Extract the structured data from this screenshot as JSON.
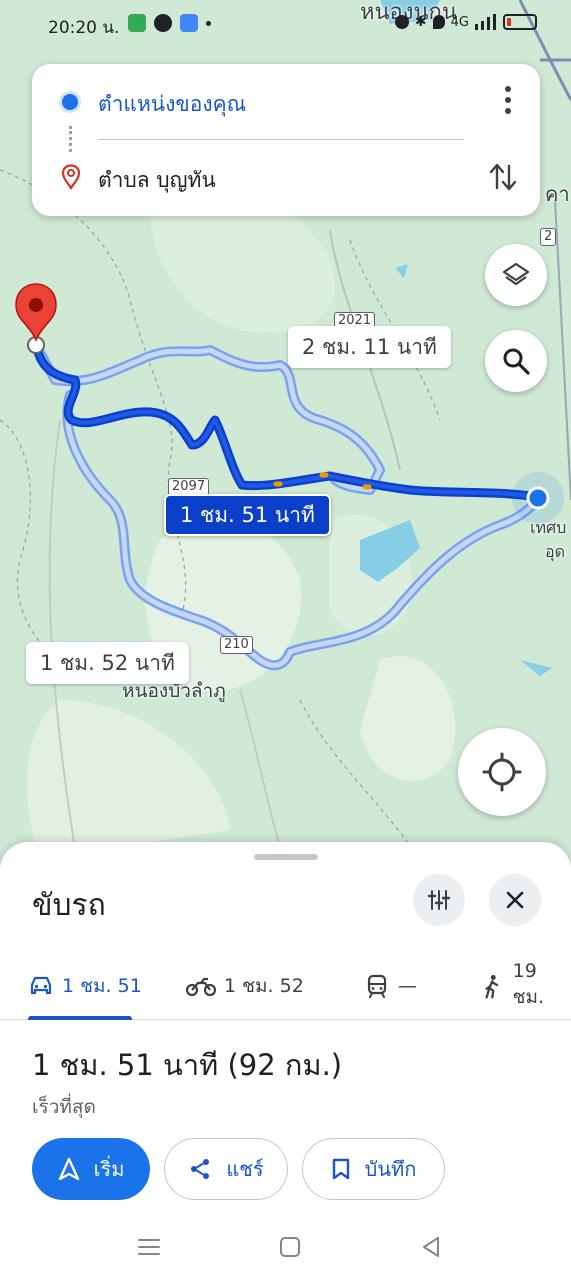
{
  "status_bar": {
    "time": "20:20 น.",
    "network": "4G",
    "map_fragment_top": "หนองนกน",
    "map_fragment_right": "คา"
  },
  "search": {
    "origin": "ตำแหน่งของคุณ",
    "destination": "ตำบล บุญทัน"
  },
  "map": {
    "route_labels": {
      "alt_top": "2 ชม. 11 นาที",
      "main": "1 ชม. 51 นาที",
      "alt_bottom": "1 ชม. 52 นาที"
    },
    "town_label": "หนองบัวลำภู",
    "town_right_1": "เทศบ",
    "town_right_2": "อุด",
    "road_shields": [
      "2021",
      "2097",
      "210",
      "2"
    ]
  },
  "sheet": {
    "title": "ขับรถ",
    "modes": [
      {
        "icon": "car-icon",
        "label": "1 ชม. 51",
        "active": true
      },
      {
        "icon": "motorcycle-icon",
        "label": "1 ชม. 52",
        "active": false
      },
      {
        "icon": "transit-icon",
        "label": "—",
        "active": false
      },
      {
        "icon": "walk-icon",
        "label": "19 ชม.",
        "active": false
      }
    ],
    "summary": "1 ชม. 51 นาที (92 กม.)",
    "subtitle": "เร็วที่สุด",
    "actions": {
      "start": "เริ่ม",
      "share": "แชร์",
      "save": "บันทึก"
    }
  },
  "colors": {
    "route_main": "#0b3fc9",
    "route_alt": "#a8c1f5",
    "accent": "#1a73e8",
    "pin": "#d93025",
    "map_green": "#cfe9d4"
  }
}
